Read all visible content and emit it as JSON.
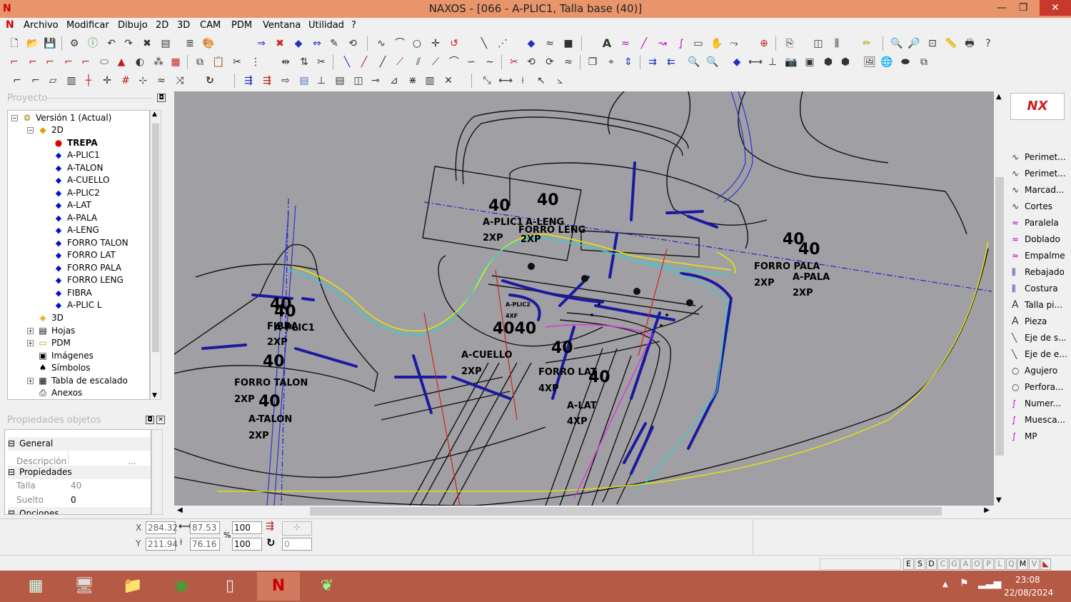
{
  "window": {
    "title": "NAXOS - [066 - A-PLIC1, Talla base (40)]",
    "app_icon": "N"
  },
  "menus": [
    "Archivo",
    "Modificar",
    "Dibujo",
    "2D",
    "3D",
    "CAM",
    "PDM",
    "Ventana",
    "Utilidad",
    "?"
  ],
  "project": {
    "title": "Proyecto",
    "tree": [
      {
        "label": "Versión 1 (Actual)"
      },
      {
        "label": "2D"
      },
      {
        "label": "TREPA"
      },
      {
        "label": "A-PLIC1"
      },
      {
        "label": "A-TALON"
      },
      {
        "label": "A-CUELLO"
      },
      {
        "label": "A-PLIC2"
      },
      {
        "label": "A-LAT"
      },
      {
        "label": "A-PALA"
      },
      {
        "label": "A-LENG"
      },
      {
        "label": "FORRO TALON"
      },
      {
        "label": "FORRO LAT"
      },
      {
        "label": "FORRO PALA"
      },
      {
        "label": "FORRO LENG"
      },
      {
        "label": "FIBRA"
      },
      {
        "label": "A-PLIC L"
      },
      {
        "label": "3D"
      },
      {
        "label": "Hojas"
      },
      {
        "label": "PDM"
      },
      {
        "label": "Imágenes"
      },
      {
        "label": "Símbolos"
      },
      {
        "label": "Tabla de escalado"
      },
      {
        "label": "Anexos"
      }
    ]
  },
  "properties": {
    "title": "Propiedades objetos",
    "general": "General",
    "descripcion_label": "Descripción",
    "descripcion_btn": "...",
    "propiedades": "Propiedades",
    "talla_label": "Talla",
    "talla_value": "40",
    "suelto_label": "Suelto",
    "suelto_value": "0",
    "opciones": "Opciones"
  },
  "canvas_labels": {
    "l40a": "40",
    "l40b": "40",
    "aplic1": "A-PLIC1",
    "aleng": "A-LENG",
    "forroleng": "FORRO LENG",
    "xp1": "2XP",
    "xp2": "2XP",
    "l40c": "40",
    "l40d": "40",
    "forropala": "FORRO PALA",
    "apala": "A-PALA",
    "xp3": "2XP",
    "xp4": "2XP",
    "l40e": "40",
    "l40f": "40",
    "fibra": "FIBRA",
    "aplic1b": "A-PLIC1",
    "xp5": "2XP",
    "l40g": "40",
    "forrotalon": "FORRO TALON",
    "xp6": "2XP",
    "l40h": "40",
    "atalon": "A-TALON",
    "xp7": "2XP",
    "aplic2": "A-PLIC2",
    "xf": "4XF",
    "l4040": "4040",
    "acuello": "A-CUELLO",
    "xp8": "2XP",
    "l40i": "40",
    "forrolat": "FORRO LAT",
    "l40j": "40",
    "xp9": "4XP",
    "alat": "A-LAT",
    "xp10": "4XP"
  },
  "tools": [
    "Perimet...",
    "Perimet...",
    "Marcad...",
    "Cortes",
    "Paralela",
    "Doblado",
    "Empalme",
    "Rebajado",
    "Costura",
    "Talla pi...",
    "Pieza",
    "Eje de s...",
    "Eje de e...",
    "Agujero",
    "Perfora...",
    "Numer...",
    "Muesca...",
    "MP"
  ],
  "coords": {
    "x_label": "X",
    "y_label": "Y",
    "x": "284.32",
    "y": "211.94",
    "w": "87.53",
    "h": "76.16",
    "pct_sign": "%",
    "sx": "100",
    "sy": "100",
    "rot": "0"
  },
  "status_letters": [
    "E",
    "S",
    "D",
    "C",
    "G",
    "A",
    "O",
    "P",
    "L",
    "Q",
    "M",
    "V"
  ],
  "clock": {
    "time": "23:08",
    "date": "22/08/2024"
  },
  "colors": {
    "title_bar": "#e8956b",
    "canvas": "#a0a0a4",
    "taskbar": "#b55a44",
    "accent": "#0010d0"
  }
}
